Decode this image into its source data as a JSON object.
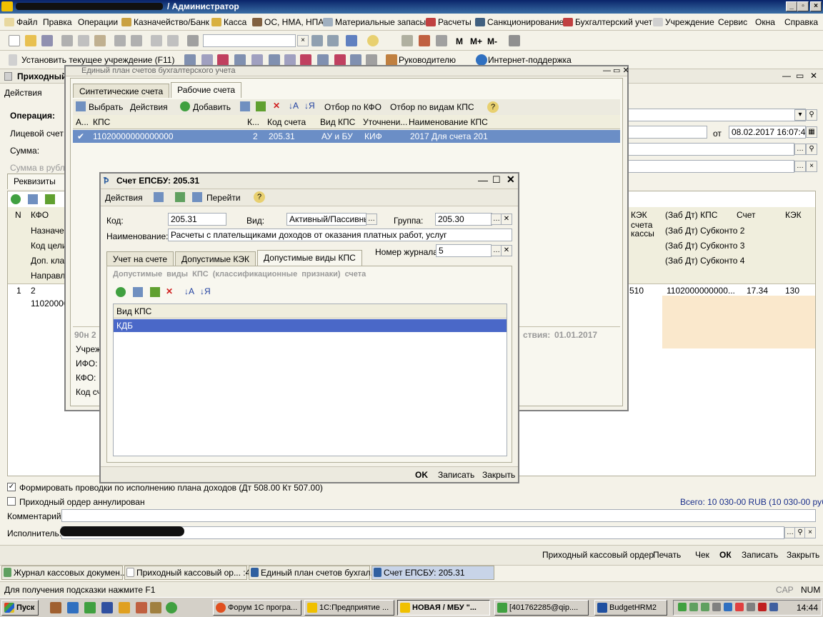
{
  "app_title": "/ Администратор",
  "menu": [
    "Файл",
    "Правка",
    "Операции",
    "Казначейство/Банк",
    "Касса",
    "ОС, НМА, НПА",
    "Материальные запасы",
    "Расчеты",
    "Санкционирование",
    "Бухгалтерский учет",
    "Учреждение",
    "Сервис",
    "Окна",
    "Справка"
  ],
  "toolbar2": {
    "set_org": "Установить текущее учреждение (F11)",
    "head": "Руководителю",
    "support": "Интернет-поддержка"
  },
  "toolbar1": {
    "m": "М",
    "mplus": "М+",
    "mminus": "М-"
  },
  "back_form": {
    "title": "Приходный",
    "actions": "Действия",
    "operation_label": "Операция:",
    "account_label": "Лицевой счет:",
    "sum_label": "Сумма:",
    "sum_rub_label": "Сумма в рублях:",
    "from_label": "от",
    "date": "08.02.2017 16:07:44",
    "tab_label": "Реквизиты",
    "cols": [
      "N",
      "КФО"
    ],
    "rows": [
      "Назначен",
      "Код цели",
      "Доп. кла",
      "Направл"
    ],
    "row_n": "1",
    "row_kfo": "2",
    "row_kps": "11020000",
    "right_head": [
      "КЭК",
      "(Заб Дт) КПС",
      "Счет",
      "КЭК"
    ],
    "right_sub": [
      "счета",
      "кассы"
    ],
    "right_rows": [
      "(Заб Дт) Субконто 2",
      "(Заб Дт) Субконто 3",
      "(Заб Дт) Субконто 4"
    ],
    "right_vals": [
      "510",
      "1102000000000...",
      "17.34",
      "130"
    ],
    "cb1": "Формировать проводки по исполнению плана доходов (Дт 508.00 Кт 507.00)",
    "cb2": "Приходный ордер аннулирован",
    "total": "Всего: 10 030-00 RUB (10 030-00 руб.)",
    "comment_label": "Комментарий:",
    "executor_label": "Исполнитель:",
    "bottom_buttons": [
      "Приходный кассовый ордер",
      "Печать",
      "Чек",
      "ОК",
      "Записать",
      "Закрыть"
    ]
  },
  "plan_win": {
    "title": "Единый план счетов бухгалтерского учета",
    "tabs": [
      "Синтетические счета",
      "Рабочие счета"
    ],
    "tb": [
      "Выбрать",
      "Действия",
      "Добавить",
      "Отбор по КФО",
      "Отбор по видам КПС"
    ],
    "cols": [
      "А...",
      "КПС",
      "К...",
      "Код счета",
      "Вид КПС",
      "Уточнени...",
      "Наименование КПС"
    ],
    "row": [
      "11020000000000000",
      "2",
      "205.31",
      "АУ и БУ",
      "КИФ",
      "2017 Для счета 201"
    ],
    "left_info": [
      "90н 2",
      "Учреж",
      "ИФО:",
      "КФО:",
      "Код сч"
    ],
    "date_lbl": "ствия:",
    "date": "01.01.2017"
  },
  "acct_win": {
    "title": "Счет ЕПСБУ: 205.31",
    "actions": "Действия",
    "goto": "Перейти",
    "code_label": "Код:",
    "code": "205.31",
    "type_label": "Вид:",
    "type": "Активный/Пассивнь",
    "group_label": "Группа:",
    "group": "205.30",
    "name_label": "Наименование:",
    "name": "Расчеты с плательщиками доходов от оказания платных работ, услуг",
    "journal_label": "Номер журнала:",
    "journal": "5",
    "tabs": [
      "Учет на счете",
      "Допустимые КЭК",
      "Допустимые виды КПС"
    ],
    "section": "Допустимые виды КПС (классификационные признаки) счета",
    "col": "Вид КПС",
    "item": "КДБ",
    "buttons": [
      "OK",
      "Записать",
      "Закрыть"
    ]
  },
  "window_tabs": [
    "Журнал кассовых докумен...",
    "Приходный кассовый ор... :44",
    "Единый план счетов бухгал...",
    "Счет ЕПСБУ: 205.31"
  ],
  "status": {
    "hint": "Для получения подсказки нажмите F1",
    "cap": "CAP",
    "num": "NUM"
  },
  "taskbar": {
    "start": "Пуск",
    "items": [
      "Форум 1С програ...",
      "1С:Предприятие ...",
      "НОВАЯ / МБУ \"...",
      "[401762285@qip....",
      "BudgetHRM2"
    ],
    "time": "14:44"
  }
}
